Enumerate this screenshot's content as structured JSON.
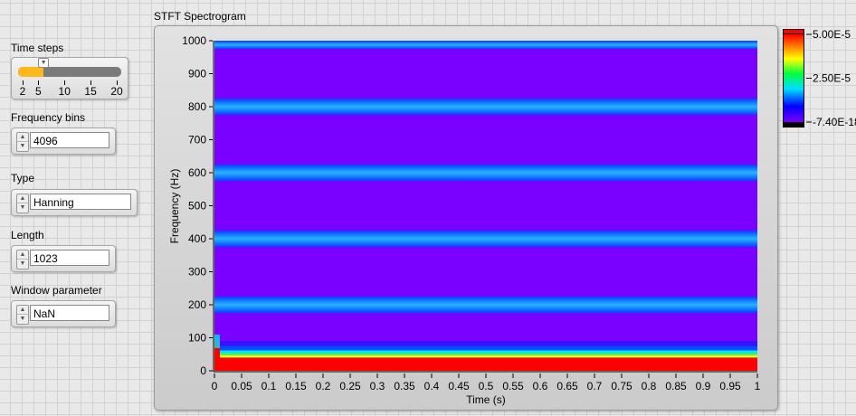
{
  "controls": {
    "time_steps": {
      "label": "Time steps",
      "value": 6,
      "min": 2,
      "max": 20,
      "ticks": [
        "2",
        "5",
        "10",
        "15",
        "20"
      ],
      "tick_values": [
        2,
        5,
        10,
        15,
        20
      ],
      "fill_color": "#ffb81c"
    },
    "frequency_bins": {
      "label": "Frequency bins",
      "value": "4096"
    },
    "type": {
      "label": "Type",
      "value": "Hanning"
    },
    "length": {
      "label": "Length",
      "value": "1023"
    },
    "window_parameter": {
      "label": "Window parameter",
      "value": "NaN"
    }
  },
  "chart_data": {
    "type": "heatmap",
    "title": "STFT Spectrogram",
    "xlabel": "Time (s)",
    "ylabel": "Frequency (Hz)",
    "xlim": [
      0,
      1
    ],
    "ylim": [
      0,
      1000
    ],
    "xticks": [
      "0",
      "0.05",
      "0.1",
      "0.15",
      "0.2",
      "0.25",
      "0.3",
      "0.35",
      "0.4",
      "0.45",
      "0.5",
      "0.55",
      "0.6",
      "0.65",
      "0.7",
      "0.75",
      "0.8",
      "0.85",
      "0.9",
      "0.95",
      "1"
    ],
    "yticks": [
      "0",
      "100",
      "200",
      "300",
      "400",
      "500",
      "600",
      "700",
      "800",
      "900",
      "1000"
    ],
    "background_color": "#7a00ff",
    "bands_hz": [
      200,
      400,
      600,
      800,
      1000
    ],
    "low_freq_layers": [
      {
        "from": 0,
        "to": 40,
        "color": "#ff0000"
      },
      {
        "from": 40,
        "to": 47,
        "color": "#e8ff00"
      },
      {
        "from": 47,
        "to": 54,
        "color": "#44ff66"
      },
      {
        "from": 54,
        "to": 62,
        "color": "#00e8ff"
      },
      {
        "from": 62,
        "to": 75,
        "color": "#0050ff"
      },
      {
        "from": 75,
        "to": 90,
        "color": "#3a10ff"
      }
    ],
    "colorbar": {
      "labels": [
        "5.00E-5",
        "2.50E-5",
        "-7.40E-18"
      ],
      "max": 5e-05,
      "mid": 2.5e-05,
      "min": -7.4e-18
    }
  }
}
